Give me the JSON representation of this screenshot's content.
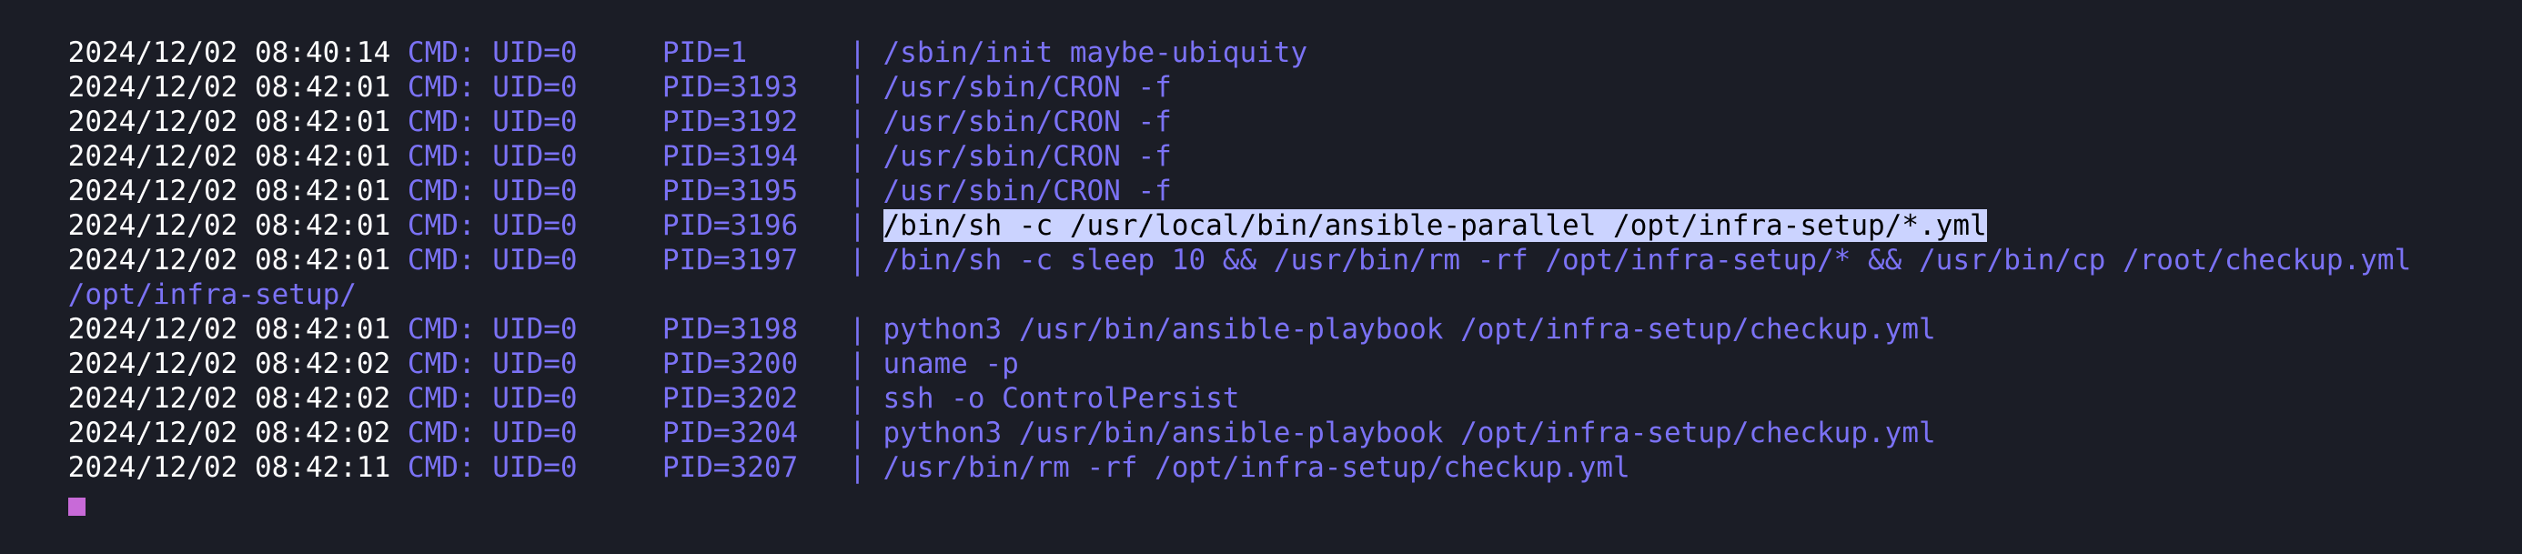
{
  "terminal": {
    "lines": [
      {
        "timestamp": "2024/12/02 08:40:14",
        "meta": " CMD: UID=0     PID=1      | ",
        "command": "/sbin/init maybe-ubiquity"
      },
      {
        "timestamp": "2024/12/02 08:42:01",
        "meta": " CMD: UID=0     PID=3193   | ",
        "command": "/usr/sbin/CRON -f"
      },
      {
        "timestamp": "2024/12/02 08:42:01",
        "meta": " CMD: UID=0     PID=3192   | ",
        "command": "/usr/sbin/CRON -f"
      },
      {
        "timestamp": "2024/12/02 08:42:01",
        "meta": " CMD: UID=0     PID=3194   | ",
        "command": "/usr/sbin/CRON -f"
      },
      {
        "timestamp": "2024/12/02 08:42:01",
        "meta": " CMD: UID=0     PID=3195   | ",
        "command": "/usr/sbin/CRON -f"
      },
      {
        "timestamp": "2024/12/02 08:42:01",
        "meta": " CMD: UID=0     PID=3196   | ",
        "command": "/bin/sh -c /usr/local/bin/ansible-parallel /opt/infra-setup/*.yml",
        "selected": true
      },
      {
        "timestamp": "2024/12/02 08:42:01",
        "meta": " CMD: UID=0     PID=3197   | ",
        "command": "/bin/sh -c sleep 10 && /usr/bin/rm -rf /opt/infra-setup/* && /usr/bin/cp /root/checkup.yml"
      },
      {
        "timestamp": "",
        "meta": "",
        "command": "/opt/infra-setup/"
      },
      {
        "timestamp": "2024/12/02 08:42:01",
        "meta": " CMD: UID=0     PID=3198   | ",
        "command": "python3 /usr/bin/ansible-playbook /opt/infra-setup/checkup.yml"
      },
      {
        "timestamp": "2024/12/02 08:42:02",
        "meta": " CMD: UID=0     PID=3200   | ",
        "command": "uname -p"
      },
      {
        "timestamp": "2024/12/02 08:42:02",
        "meta": " CMD: UID=0     PID=3202   | ",
        "command": "ssh -o ControlPersist"
      },
      {
        "timestamp": "2024/12/02 08:42:02",
        "meta": " CMD: UID=0     PID=3204   | ",
        "command": "python3 /usr/bin/ansible-playbook /opt/infra-setup/checkup.yml"
      },
      {
        "timestamp": "2024/12/02 08:42:11",
        "meta": " CMD: UID=0     PID=3207   | ",
        "command": "/usr/bin/rm -rf /opt/infra-setup/checkup.yml"
      }
    ],
    "colors": {
      "background": "#1b1d26",
      "timestamp": "#ffffff",
      "accent": "#7b72f5",
      "selection": "#cbd3ff",
      "cursor": "#c86ad8"
    }
  }
}
